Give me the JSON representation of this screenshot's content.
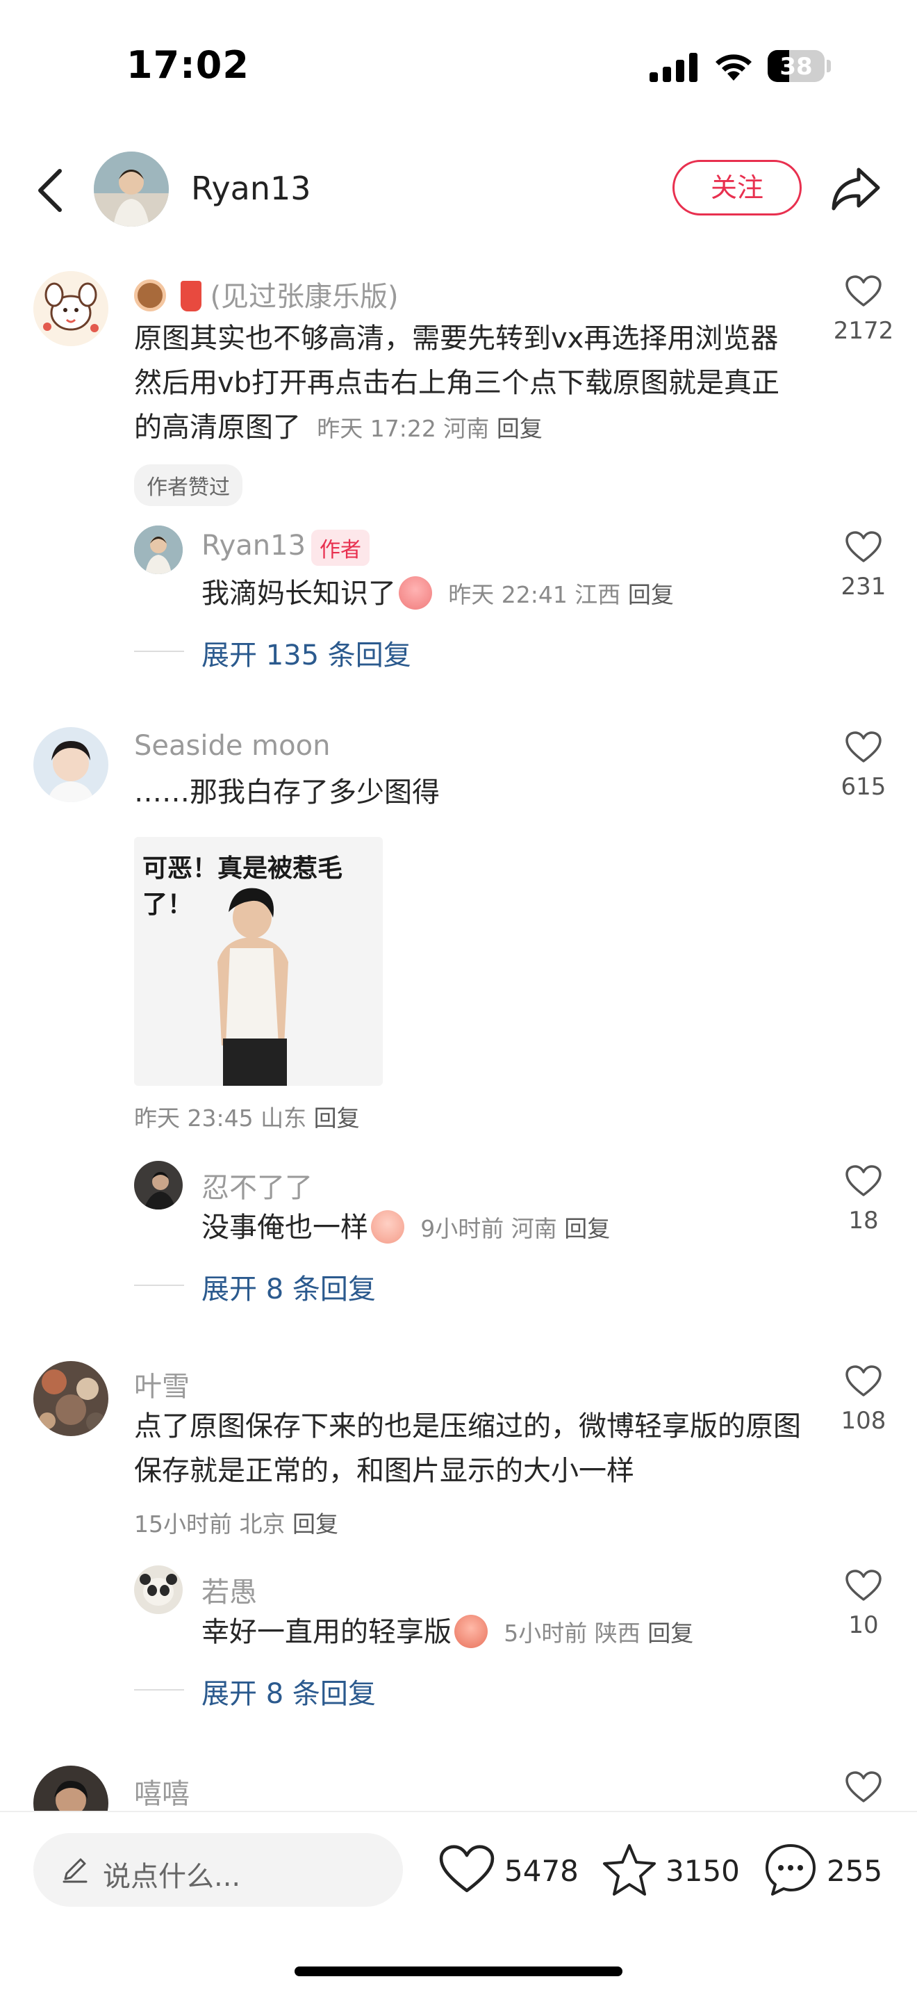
{
  "status": {
    "time": "17:02",
    "battery": "38",
    "battery_level": 0.38
  },
  "header": {
    "username": "Ryan13",
    "follow_label": "关注"
  },
  "comments": [
    {
      "emoji_prefix": "🍩🥤",
      "name": "(见过张康乐版)",
      "text": "原图其实也不够高清，需要先转到vx再选择用浏览器然后用vb打开再点击右上角三个点下载原图就是真正的高清原图了",
      "meta": "昨天 17:22 河南",
      "reply_label": "回复",
      "author_liked": "作者赞过",
      "likes": "2172",
      "sub": {
        "name": "Ryan13",
        "author_tag": "作者",
        "text": "我滴妈长知识了",
        "meta": "昨天 22:41 江西",
        "reply_label": "回复",
        "likes": "231"
      },
      "expand": "展开 135 条回复"
    },
    {
      "name": "Seaside moon",
      "text": "……那我白存了多少图得",
      "sticker_text": "可恶！真是被惹毛了！",
      "meta": "昨天 23:45 山东",
      "reply_label": "回复",
      "likes": "615",
      "sub": {
        "name": "忍不了了",
        "text": "没事俺也一样",
        "meta": "9小时前 河南",
        "reply_label": "回复",
        "likes": "18"
      },
      "expand": "展开 8 条回复"
    },
    {
      "name": "叶雪",
      "text": "点了原图保存下来的也是压缩过的，微博轻享版的原图保存就是正常的，和图片显示的大小一样",
      "meta": "15小时前 北京",
      "reply_label": "回复",
      "likes": "108",
      "sub": {
        "name": "若愚",
        "text": "幸好一直用的轻享版",
        "meta": "5小时前 陕西",
        "reply_label": "回复",
        "likes": "10"
      },
      "expand": "展开 8 条回复"
    },
    {
      "name": "嘻嘻"
    }
  ],
  "bottom": {
    "placeholder": "说点什么...",
    "likes": "5478",
    "favorites": "3150",
    "comments": "255"
  },
  "colors": {
    "accent": "#e8304f",
    "link": "#2b5a8e"
  }
}
